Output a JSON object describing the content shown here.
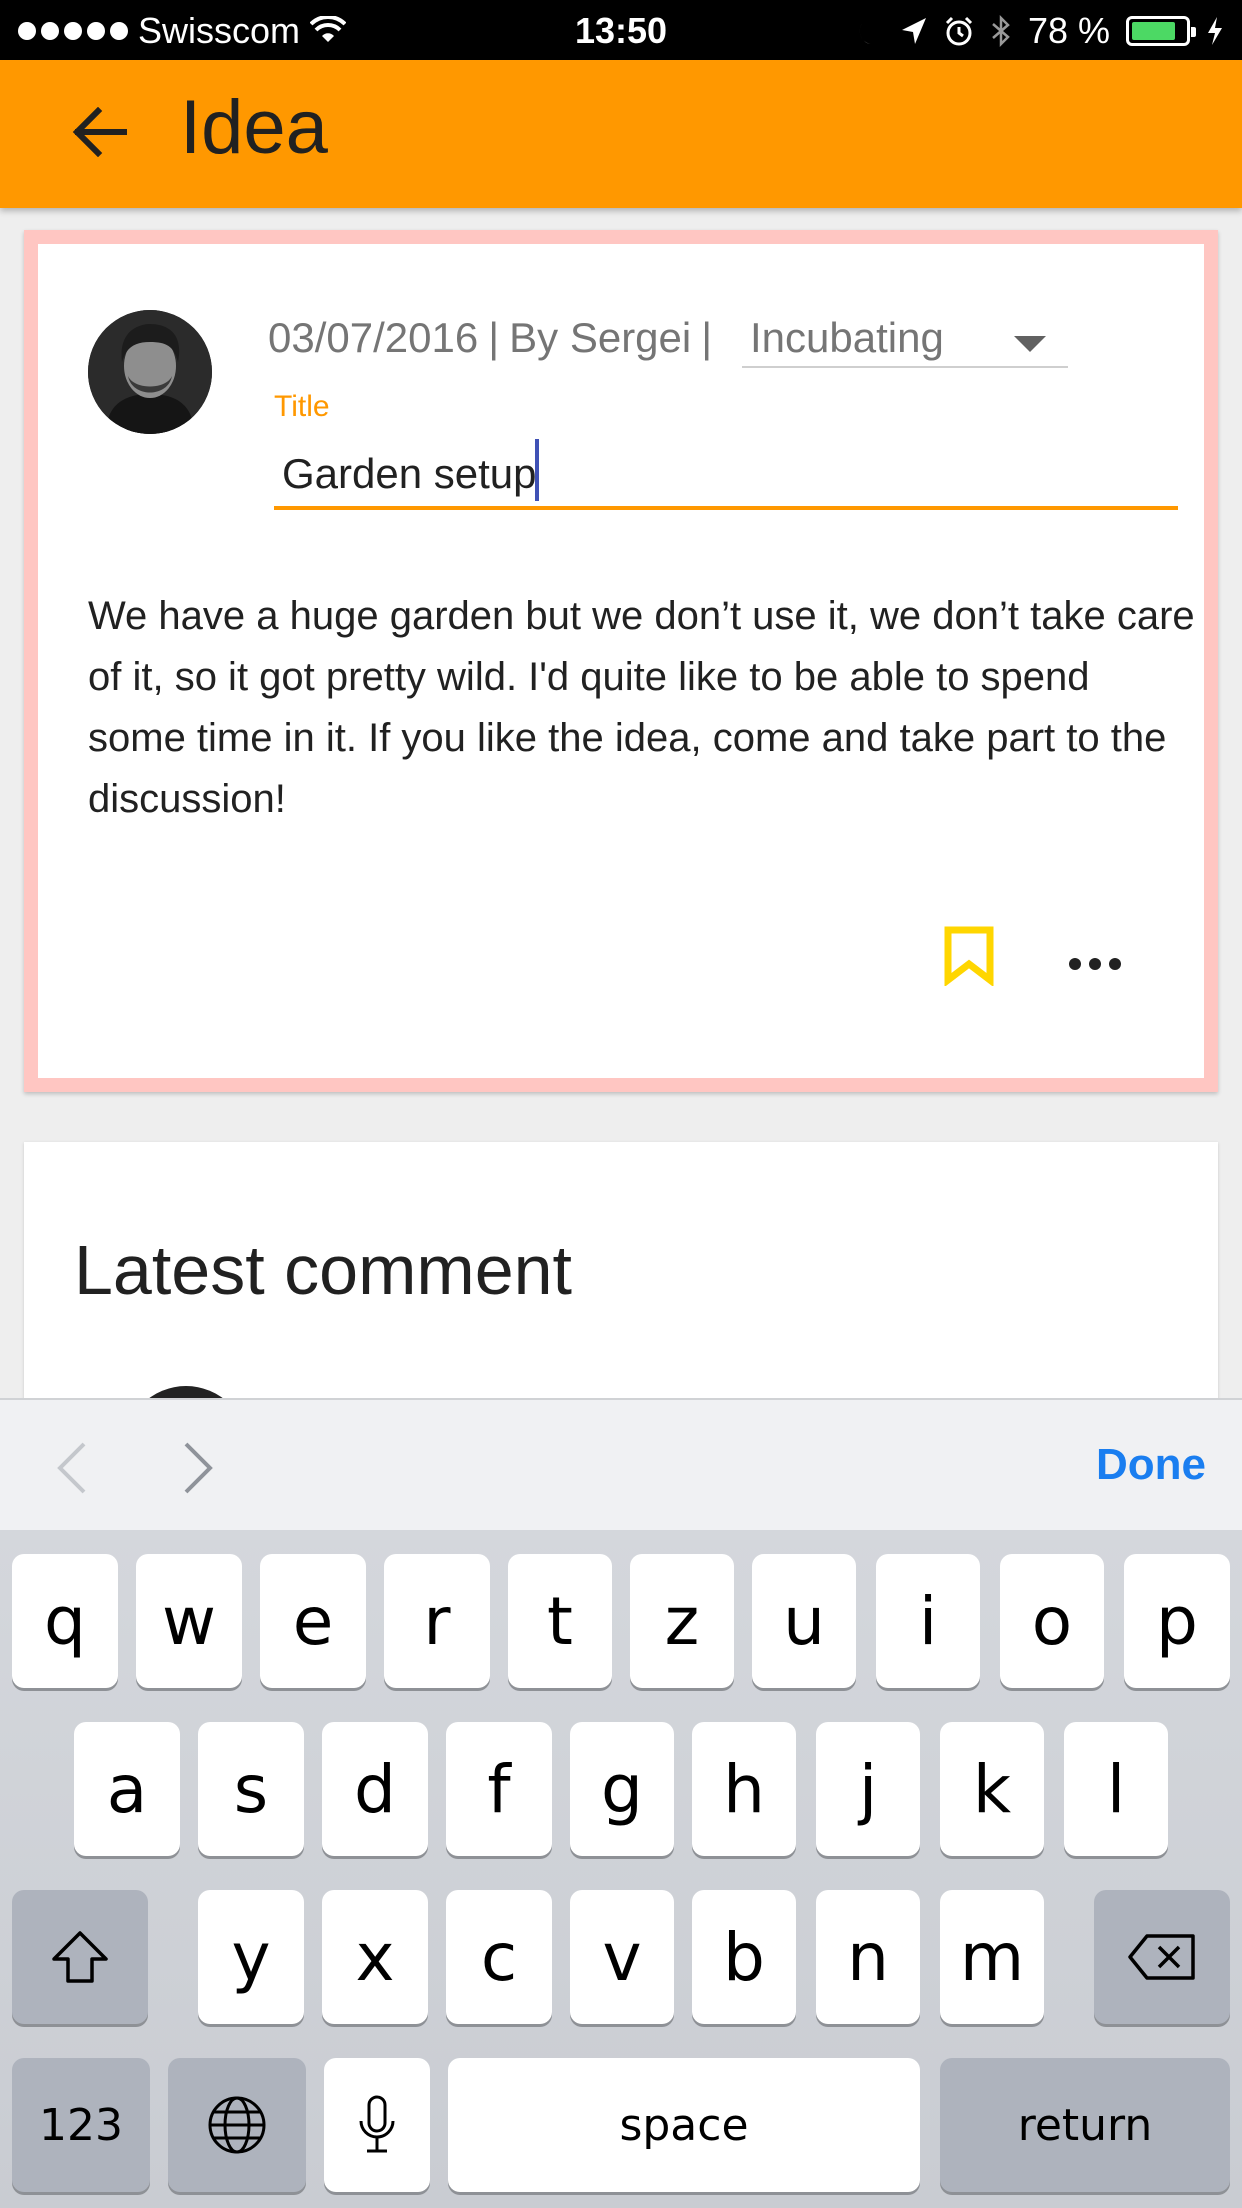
{
  "status_bar": {
    "carrier": "Swisscom",
    "time": "13:50",
    "battery": "78 %",
    "battery_level": 0.78
  },
  "app_bar": {
    "title": "Idea",
    "back_icon": "arrow-left-icon"
  },
  "idea": {
    "date": "03/07/2016",
    "separator": "|",
    "author": "By Sergei",
    "status": "Incubating",
    "title_label": "Title",
    "title_value": "Garden setup",
    "description": "We have a huge garden but we don’t use it, we don’t take care of it, so it got pretty wild. I'd quite like to be able to spend some time in it. If you like the idea, come and take part to the discussion!",
    "bookmark_color": "#ffd600"
  },
  "comments": {
    "heading": "Latest comment"
  },
  "keyboard_accessory": {
    "done": "Done"
  },
  "keyboard": {
    "row1": [
      "q",
      "w",
      "e",
      "r",
      "t",
      "z",
      "u",
      "i",
      "o",
      "p"
    ],
    "row2": [
      "a",
      "s",
      "d",
      "f",
      "g",
      "h",
      "j",
      "k",
      "l"
    ],
    "row3": [
      "y",
      "x",
      "c",
      "v",
      "b",
      "n",
      "m"
    ],
    "numbers": "123",
    "space": "space",
    "return": "return"
  },
  "colors": {
    "accent": "#ff9800",
    "card_highlight": "#ffc6c2",
    "done_blue": "#1a7ef0"
  }
}
